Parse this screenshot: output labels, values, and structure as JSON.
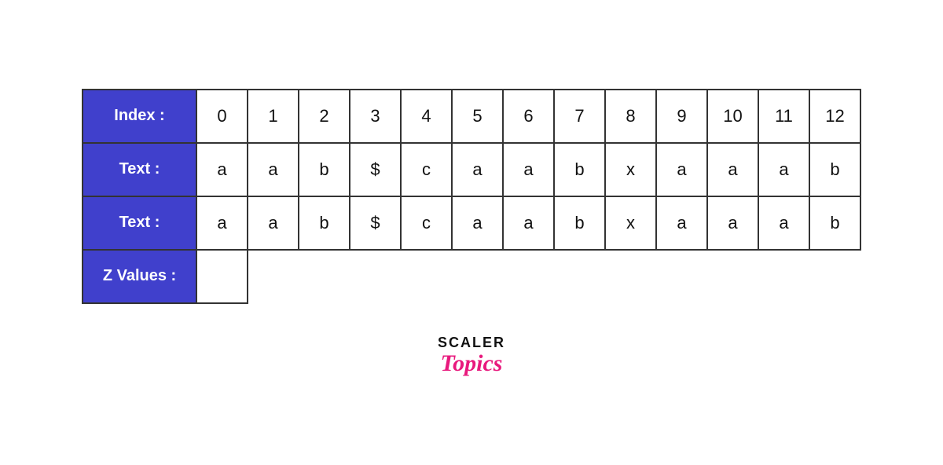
{
  "table": {
    "rows": [
      {
        "label": "Index :",
        "cells": [
          "0",
          "1",
          "2",
          "3",
          "4",
          "5",
          "6",
          "7",
          "8",
          "9",
          "10",
          "11",
          "12"
        ]
      },
      {
        "label": "Text :",
        "cells": [
          "a",
          "a",
          "b",
          "$",
          "c",
          "a",
          "a",
          "b",
          "x",
          "a",
          "a",
          "a",
          "b"
        ]
      },
      {
        "label": "Text :",
        "cells": [
          "a",
          "a",
          "b",
          "$",
          "c",
          "a",
          "a",
          "b",
          "x",
          "a",
          "a",
          "a",
          "b"
        ]
      },
      {
        "label": "Z Values :",
        "cells": [
          "",
          "",
          "",
          "",
          "",
          "",
          "",
          "",
          "",
          "",
          "",
          "",
          ""
        ]
      }
    ]
  },
  "logo": {
    "scaler": "SCALER",
    "topics": "Topics"
  }
}
